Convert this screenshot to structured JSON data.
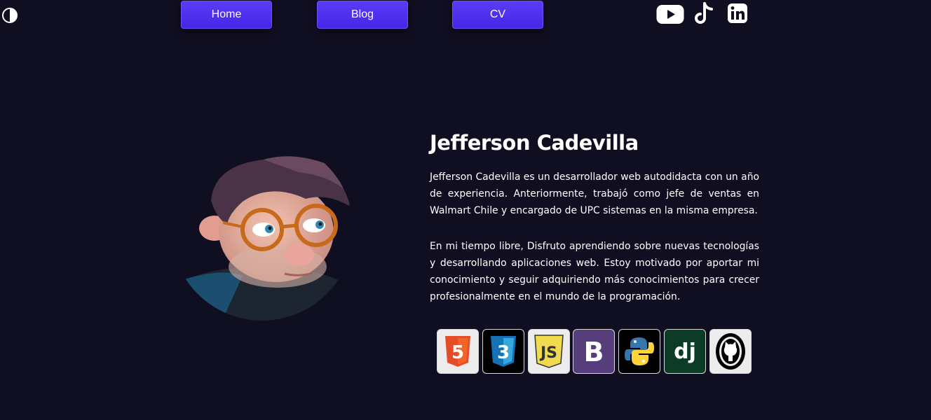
{
  "theme_toggle": {
    "icon": "half-moon-icon"
  },
  "nav": {
    "home_label": "Home",
    "blog_label": "Blog",
    "cv_label": "CV"
  },
  "social": [
    {
      "icon": "youtube-icon"
    },
    {
      "icon": "tiktok-icon"
    },
    {
      "icon": "linkedin-icon"
    }
  ],
  "profile": {
    "avatar": "cartoon-avatar-portrait",
    "name": "Jefferson Cadevilla",
    "paragraph_1": "Jefferson Cadevilla es un desarrollador web autodidacta con un año de experiencia. Anteriormente, trabajó como jefe de ventas en Walmart Chile y encargado de UPC sistemas en la misma empresa.",
    "paragraph_2": "En mi tiempo libre, Disfruto aprendiendo sobre nuevas tecnologías y desarrollando aplicaciones web. Estoy motivado por aportar mi conocimiento y seguir adquiriendo más conocimientos para crecer profesionalmente en el mundo de la programación."
  },
  "technologies": [
    {
      "icon": "html5-icon",
      "text": "5",
      "bg": "#ececec",
      "color": "#e44d26"
    },
    {
      "icon": "css3-icon",
      "text": "3",
      "bg": "#000000",
      "color": "#1572b6"
    },
    {
      "icon": "javascript-icon",
      "text": "JS",
      "bg": "#ececec",
      "color": "#f0db4f"
    },
    {
      "icon": "bootstrap-icon",
      "text": "B",
      "bg": "#563d7c",
      "color": "#ffffff"
    },
    {
      "icon": "python-icon",
      "bg": "#000000",
      "color": "#3776ab"
    },
    {
      "icon": "django-icon",
      "text": "dj",
      "bg": "#0c3c26",
      "color": "#ffffff"
    },
    {
      "icon": "github-icon",
      "bg": "#ececec",
      "color": "#000000"
    }
  ],
  "colors": {
    "background": "#100e21",
    "button": "#4a2ff0",
    "text": "#ffffff"
  }
}
